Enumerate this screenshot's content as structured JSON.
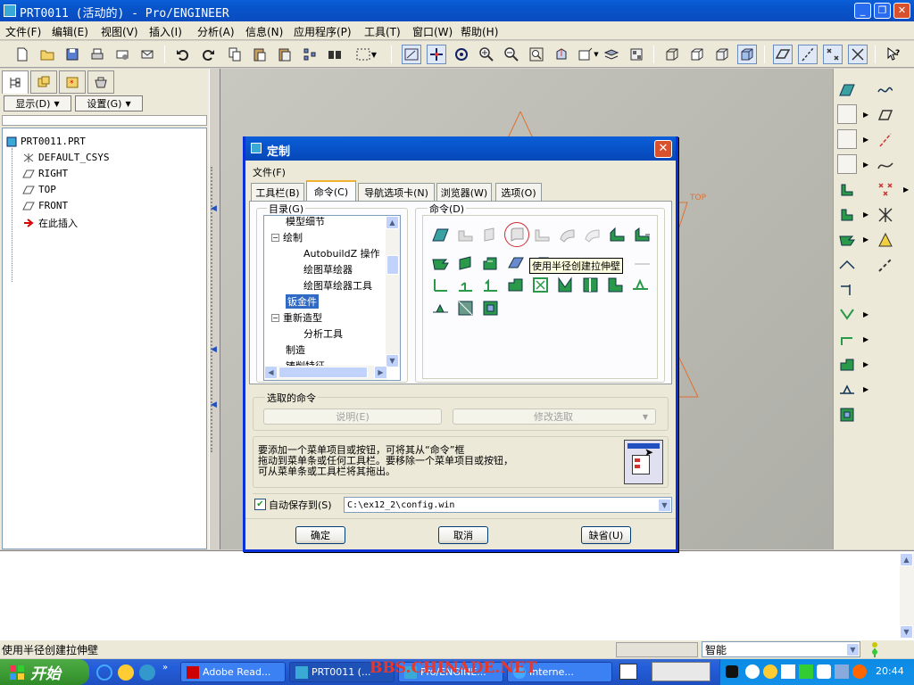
{
  "window": {
    "title": "PRT0011 (活动的) - Pro/ENGINEER",
    "controls": [
      "_",
      "❐",
      "✕"
    ]
  },
  "menubar": [
    "文件(F)",
    "编辑(E)",
    "视图(V)",
    "插入(I)",
    "分析(A)",
    "信息(N)",
    "应用程序(P)",
    "工具(T)",
    "窗口(W)",
    "帮助(H)"
  ],
  "leftpanel": {
    "show_label": "显示(D)",
    "settings_label": "设置(G)",
    "tree": [
      {
        "label": "PRT0011.PRT",
        "icon": "part-icon"
      },
      {
        "label": "DEFAULT_CSYS",
        "icon": "csys-icon"
      },
      {
        "label": "RIGHT",
        "icon": "datum-plane-icon"
      },
      {
        "label": "TOP",
        "icon": "datum-plane-icon"
      },
      {
        "label": "FRONT",
        "icon": "datum-plane-icon"
      },
      {
        "label": "在此插入",
        "icon": "insert-arrow-icon"
      }
    ]
  },
  "graphics": {
    "datum_label": "TOP",
    "colors": {
      "datum_line": "#e07030"
    }
  },
  "dialog": {
    "title": "定制",
    "menu_file": "文件(F)",
    "tabs": [
      "工具栏(B)",
      "命令(C)",
      "导航选项卡(N)",
      "浏览器(W)",
      "选项(O)"
    ],
    "active_tab": "命令(C)",
    "catalog": {
      "label": "目录(G)",
      "items": [
        {
          "label": "模型细节",
          "indent": 1
        },
        {
          "label": "绘制",
          "indent": 0,
          "expand": "−"
        },
        {
          "label": "AutobuildZ 操作",
          "indent": 2
        },
        {
          "label": "绘图草绘器",
          "indent": 2
        },
        {
          "label": "绘图草绘器工具",
          "indent": 2
        },
        {
          "label": "钣金件",
          "indent": 1,
          "selected": true
        },
        {
          "label": "重新造型",
          "indent": 0,
          "expand": "−"
        },
        {
          "label": "分析工具",
          "indent": 2
        },
        {
          "label": "制造",
          "indent": 1
        },
        {
          "label": "铸削特征",
          "indent": 1
        }
      ]
    },
    "commands_label": "命令(D)",
    "tooltip": "使用半径创建拉伸壁",
    "selected_cmd": {
      "label": "选取的命令",
      "describe": "说明(E)",
      "modify": "修改选取"
    },
    "help_text": [
      "要添加一个菜单项目或按钮，可将其从“命令”框",
      "拖动到菜单条或任何工具栏。要移除一个菜单项目或按钮，",
      "可从菜单条或工具栏将其拖出。"
    ],
    "autosave": {
      "checked": true,
      "label": "自动保存到(S)",
      "path": "C:\\ex12_2\\config.win"
    },
    "buttons": {
      "ok": "确定",
      "cancel": "取消",
      "default": "缺省(U)"
    }
  },
  "statusbar": {
    "message": "使用半径创建拉伸壁",
    "filter": "智能"
  },
  "taskbar": {
    "start": "开始",
    "tasks": [
      {
        "label": "Adobe Read...",
        "active": false
      },
      {
        "label": "PRT0011 (...",
        "active": true
      },
      {
        "label": "Pro/ENGINE...",
        "active": false
      },
      {
        "label": "Interne...",
        "active": false
      }
    ],
    "watermark": "BBS.CHINADE.NET",
    "clock": "20:44"
  }
}
